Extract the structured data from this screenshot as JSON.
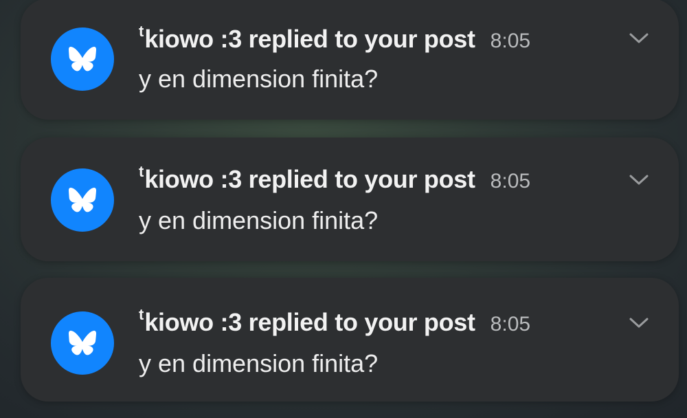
{
  "app": {
    "brand_color": "#1185fe",
    "icon": "butterfly-icon"
  },
  "notifications": [
    {
      "sender_prefix": "t",
      "title": "kiowo :3 replied to your post",
      "time": "8:05",
      "body": "y en dimension finita?",
      "expand_icon": "chevron-down-icon"
    },
    {
      "sender_prefix": "t",
      "title": "kiowo :3 replied to your post",
      "time": "8:05",
      "body": "y en dimension finita?",
      "expand_icon": "chevron-down-icon"
    },
    {
      "sender_prefix": "t",
      "title": "kiowo :3 replied to your post",
      "time": "8:05",
      "body": "y en dimension finita?",
      "expand_icon": "chevron-down-icon"
    }
  ]
}
